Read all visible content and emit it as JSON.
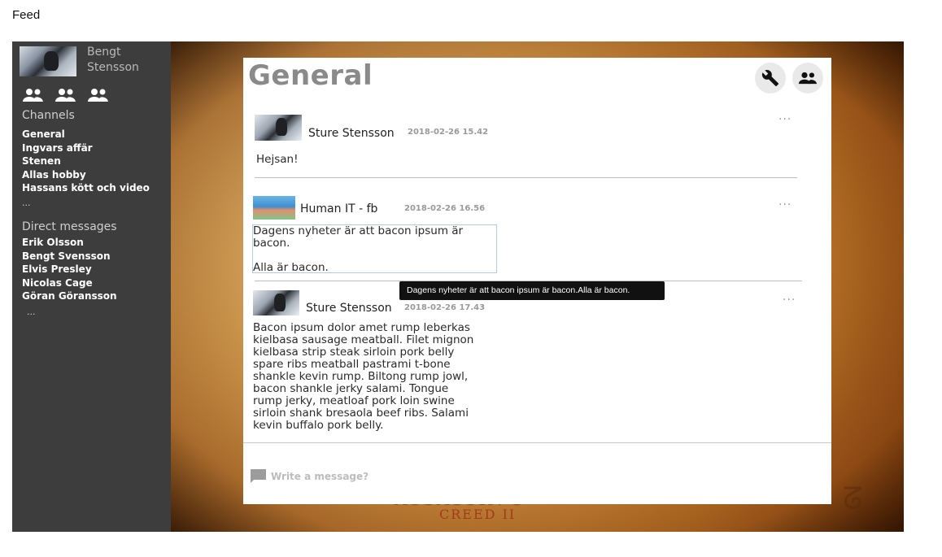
{
  "page": {
    "title": "Feed"
  },
  "sidebar": {
    "profile": {
      "name": "Bengt Stensson"
    },
    "group_icons": [
      "group-icon",
      "group-icon",
      "group-icon"
    ],
    "channels_heading": "Channels",
    "channels": [
      "General",
      "Ingvars affär",
      "Stenen",
      "Allas hobby",
      "Hassans kött och video"
    ],
    "channels_more": "...",
    "dm_heading": "Direct messages",
    "direct_messages": [
      "Erik Olsson",
      "Bengt Svensson",
      "Elvis Presley",
      "Nicolas Cage",
      "Göran Göransson"
    ],
    "dm_more": "..."
  },
  "background": {
    "logo_line1": "ASSASSIN'S",
    "logo_line2": "CREED II"
  },
  "channel": {
    "title": "General",
    "settings_icon": "wrench-icon",
    "members_icon": "group-icon"
  },
  "messages": [
    {
      "author": "Sture Stensson",
      "time": "2018-02-26 15.42",
      "text": "Hejsan!",
      "more": "..."
    },
    {
      "author": "Human IT - fb",
      "time": "2018-02-26 16.56",
      "text": "Dagens nyheter är att bacon ipsum är\nbacon.\n\nAlla är bacon.",
      "more": "..."
    },
    {
      "author": "Sture Stensson",
      "time": "2018-02-26 17.43",
      "text": "Bacon ipsum dolor amet rump leberkas\nkielbasa sausage meatball. Filet mignon\nkielbasa strip steak sirloin pork belly\nspare ribs meatball pastrami t-bone\nshankle kevin rump. Biltong rump jowl,\nbacon shankle jerky salami. Tongue\nrump jerky, meatloaf pork loin swine\nsirloin shank bresaola beef ribs. Salami\nkevin buffalo pork belly.",
      "more": "..."
    }
  ],
  "tooltip": {
    "text": "Dagens nyheter är att bacon ipsum är bacon.Alla är bacon."
  },
  "composer": {
    "placeholder": "Write a message?",
    "value": "",
    "icon": "chat-bubble-icon"
  },
  "colors": {
    "sidebar_bg": "#3d3d3d",
    "panel_bg": "#ffffff",
    "title_gray": "#8a8a8a"
  }
}
